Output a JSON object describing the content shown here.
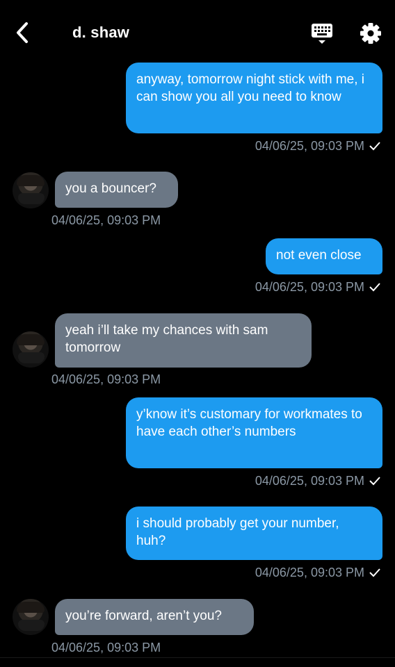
{
  "header": {
    "title": "d. shaw",
    "back_icon": "chevron-left-icon",
    "keyboard_icon": "keyboard-icon",
    "settings_icon": "gear-icon"
  },
  "messages": [
    {
      "direction": "outgoing",
      "text": "anyway, tomorrow night stick with me, i can show you all you need to know",
      "timestamp": "04/06/25, 09:03 PM",
      "read": true
    },
    {
      "direction": "incoming",
      "text": "you a bouncer?",
      "timestamp": "04/06/25, 09:03 PM"
    },
    {
      "direction": "outgoing",
      "text": "not even close",
      "timestamp": "04/06/25, 09:03 PM",
      "read": true
    },
    {
      "direction": "incoming",
      "text": "yeah i’ll take my chances with sam tomorrow",
      "timestamp": "04/06/25, 09:03 PM"
    },
    {
      "direction": "outgoing",
      "text": "y’know it’s customary for workmates to have each other’s numbers",
      "timestamp": "04/06/25, 09:03 PM",
      "read": true
    },
    {
      "direction": "outgoing",
      "text": "i should probably get your number, huh?",
      "timestamp": "04/06/25, 09:03 PM",
      "read": true
    },
    {
      "direction": "incoming",
      "text": "you’re forward, aren’t you?",
      "timestamp": "04/06/25, 09:03 PM"
    }
  ],
  "colors": {
    "outgoing": "#1d9bf0",
    "incoming": "#6b7785",
    "meta": "#8b98a5",
    "background": "#000000"
  }
}
